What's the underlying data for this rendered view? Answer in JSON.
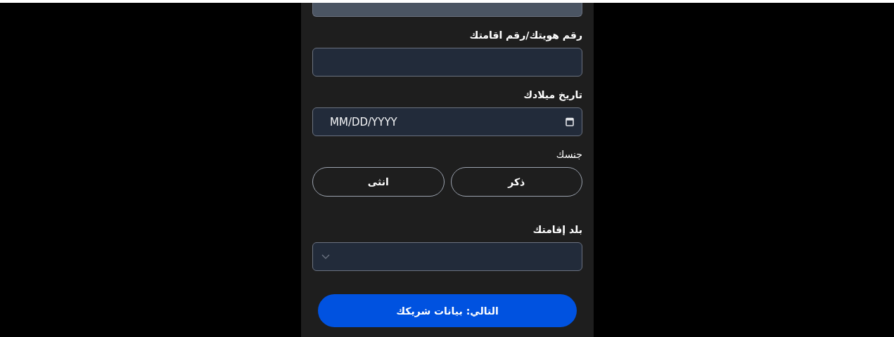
{
  "top_field": {
    "disabled": true
  },
  "fields": [
    {
      "kind": "text",
      "label": "رقم هويتك/رقم اقامتك"
    },
    {
      "kind": "date",
      "label": "تاريخ ميلادك",
      "placeholder": "MM/DD/YYYY"
    },
    {
      "kind": "choice",
      "label": "جنسك",
      "options": [
        {
          "label": "ذكر",
          "selected": false
        },
        {
          "label": "انثى",
          "selected": false
        }
      ]
    },
    {
      "kind": "select",
      "label": "بلد إقامتك"
    }
  ],
  "next_button": "التالي: بيانات شريكك"
}
